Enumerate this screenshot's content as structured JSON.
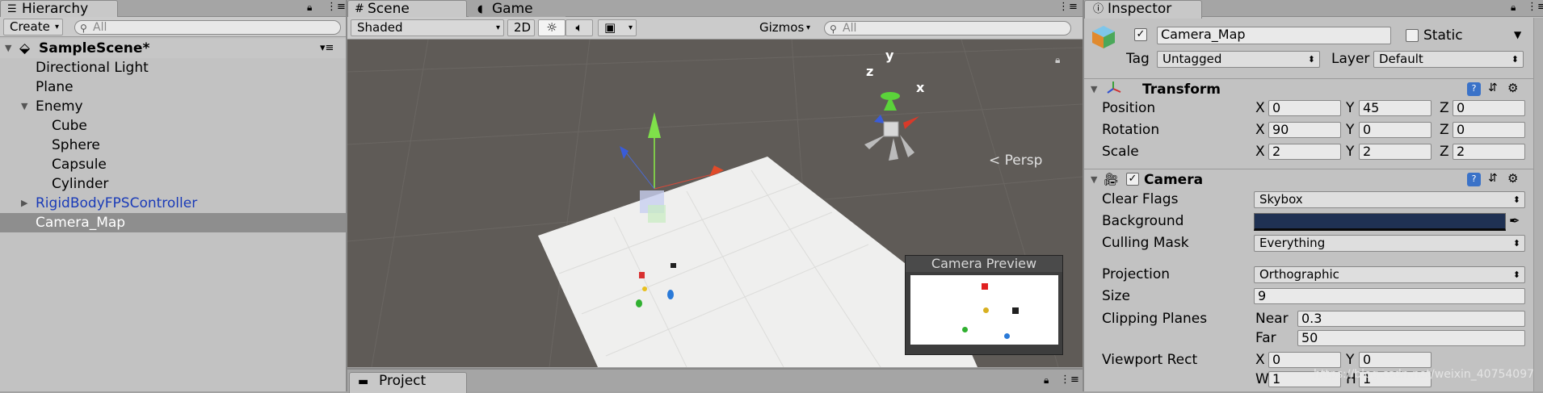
{
  "hierarchy": {
    "tab_label": "Hierarchy",
    "create_label": "Create",
    "search_placeholder": "All",
    "scene_name": "SampleScene*",
    "items": [
      {
        "label": "Directional Light"
      },
      {
        "label": "Plane"
      },
      {
        "label": "Enemy"
      },
      {
        "label": "Cube"
      },
      {
        "label": "Sphere"
      },
      {
        "label": "Capsule"
      },
      {
        "label": "Cylinder"
      },
      {
        "label": "RigidBodyFPSController"
      },
      {
        "label": "Camera_Map"
      }
    ]
  },
  "scene": {
    "tab_scene": "Scene",
    "tab_game": "Game",
    "shading_mode": "Shaded",
    "mode_2d": "2D",
    "gizmos_label": "Gizmos",
    "search_placeholder": "All",
    "persp_label": "Persp",
    "axis_x": "x",
    "axis_y": "y",
    "axis_z": "z",
    "camera_preview_title": "Camera Preview"
  },
  "project": {
    "tab_label": "Project"
  },
  "inspector": {
    "tab_label": "Inspector",
    "object_name": "Camera_Map",
    "static_label": "Static",
    "tag_label": "Tag",
    "tag_value": "Untagged",
    "layer_label": "Layer",
    "layer_value": "Default",
    "transform": {
      "title": "Transform",
      "position_label": "Position",
      "rotation_label": "Rotation",
      "scale_label": "Scale",
      "position": {
        "x": "0",
        "y": "45",
        "z": "0"
      },
      "rotation": {
        "x": "90",
        "y": "0",
        "z": "0"
      },
      "scale": {
        "x": "2",
        "y": "2",
        "z": "2"
      }
    },
    "camera": {
      "title": "Camera",
      "clear_flags_label": "Clear Flags",
      "clear_flags_value": "Skybox",
      "background_label": "Background",
      "background_color": "#1f3153",
      "culling_mask_label": "Culling Mask",
      "culling_mask_value": "Everything",
      "projection_label": "Projection",
      "projection_value": "Orthographic",
      "size_label": "Size",
      "size_value": "9",
      "clipping_label": "Clipping Planes",
      "near_label": "Near",
      "near_value": "0.3",
      "far_label": "Far",
      "far_value": "50",
      "viewport_label": "Viewport Rect",
      "viewport": {
        "x": "0",
        "y": "0",
        "w": "1",
        "h": "1"
      }
    }
  },
  "axis_letters": {
    "x": "X",
    "y": "Y",
    "z": "Z",
    "w": "W",
    "h": "H"
  },
  "watermark": "https://blog.csdn.net/weixin_40754097",
  "colors": {
    "panel_bg": "#c2c2c2",
    "viewport_bg": "#5f5b57",
    "selected_row": "#8e8e8e",
    "prefab_blue": "#1a3bb8"
  }
}
